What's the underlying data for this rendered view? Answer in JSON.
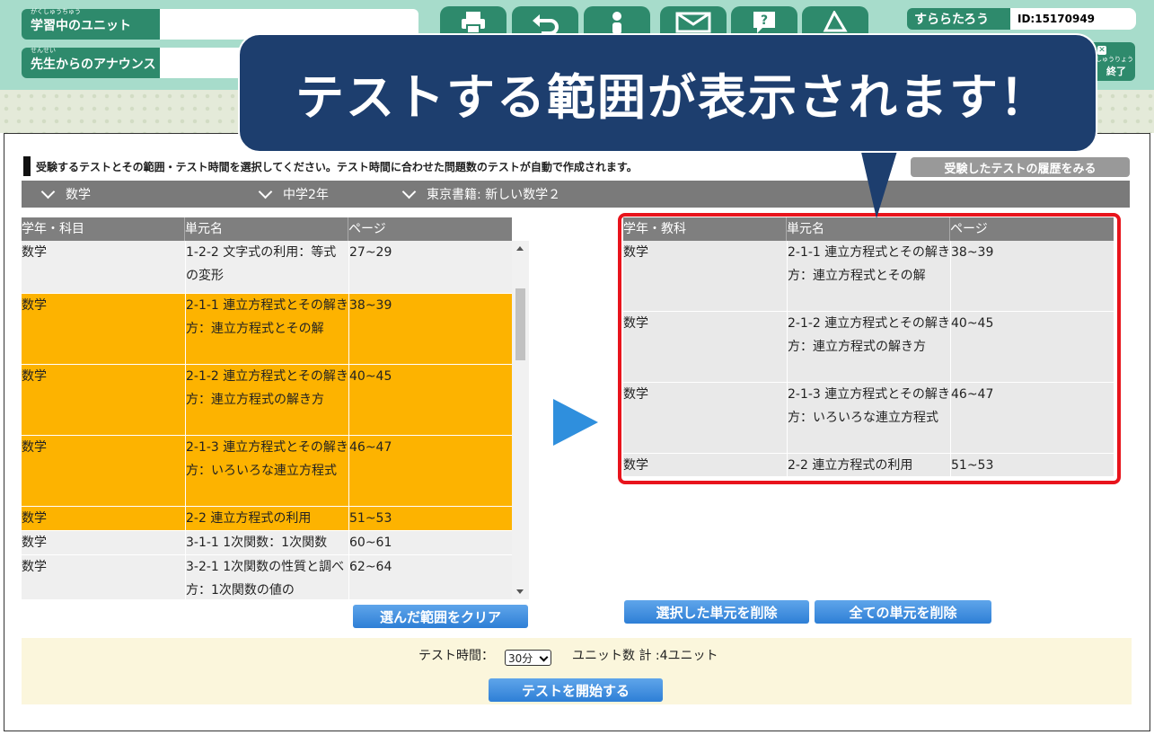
{
  "header": {
    "learning_unit_label": "学習中のユニット",
    "learning_unit_ruby": "がくしゅうちゅう",
    "announce_label": "先生からのアナウンス",
    "announce_ruby": "せんせい",
    "user_name": "すららたろう",
    "user_id": "ID:15170949",
    "end_label": "終了",
    "end_ruby": "しゅうりょう"
  },
  "callout": {
    "text": "テストする範囲が表示されます！"
  },
  "instruction": "受験するテストとその範囲・テスト時間を選択してください。テスト時間に合わせた問題数のテストが自動で作成されます。",
  "history_button": "受験したテストの履歴をみる",
  "filters": {
    "subject": "数学",
    "grade": "中学2年",
    "textbook": "東京書籍: 新しい数学２"
  },
  "left_table": {
    "headers": [
      "学年・科目",
      "単元名",
      "ページ"
    ],
    "rows": [
      {
        "subject": "数学",
        "unit": "1-2-2 文字式の利用：等式の変形",
        "page": "27~29",
        "selected": false
      },
      {
        "subject": "数学",
        "unit": "2-1-1 連立方程式とその解き方：連立方程式とその解",
        "page": "38~39",
        "selected": true
      },
      {
        "subject": "数学",
        "unit": "2-1-2 連立方程式とその解き方：連立方程式の解き方",
        "page": "40~45",
        "selected": true
      },
      {
        "subject": "数学",
        "unit": "2-1-3 連立方程式とその解き方：いろいろな連立方程式",
        "page": "46~47",
        "selected": true
      },
      {
        "subject": "数学",
        "unit": "2-2 連立方程式の利用",
        "page": "51~53",
        "selected": true
      },
      {
        "subject": "数学",
        "unit": "3-1-1 1次関数：1次関数",
        "page": "60~61",
        "selected": false
      },
      {
        "subject": "数学",
        "unit": "3-2-1 1次関数の性質と調べ方：1次関数の値の",
        "page": "62~64",
        "selected": false
      }
    ]
  },
  "right_table": {
    "headers": [
      "学年・教科",
      "単元名",
      "ページ"
    ],
    "rows": [
      {
        "subject": "数学",
        "unit": "2-1-1 連立方程式とその解き方：連立方程式とその解",
        "page": "38~39"
      },
      {
        "subject": "数学",
        "unit": "2-1-2 連立方程式とその解き方：連立方程式の解き方",
        "page": "40~45"
      },
      {
        "subject": "数学",
        "unit": "2-1-3 連立方程式とその解き方：いろいろな連立方程式",
        "page": "46~47"
      },
      {
        "subject": "数学",
        "unit": "2-2 連立方程式の利用",
        "page": "51~53"
      }
    ]
  },
  "buttons": {
    "clear_selection": "選んだ範囲をクリア",
    "delete_selected": "選択した単元を削除",
    "delete_all": "全ての単元を削除",
    "start_test": "テストを開始する"
  },
  "footer": {
    "test_time_label": "テスト時間：",
    "test_time_value": "30分",
    "unit_count": "ユニット数 計 :4ユニット"
  },
  "colors": {
    "header_green": "#2e8a6c",
    "selected_row": "#fdb300",
    "callout_bg": "#1d3e6e",
    "highlight_red": "#e8141c",
    "button_blue": "#2e7fd6"
  },
  "icons": [
    "print-icon",
    "back-icon",
    "person-icon",
    "mail-icon",
    "help-icon",
    "megaphone-icon",
    "close-icon",
    "chevron-down-icon",
    "play-arrow-icon"
  ]
}
